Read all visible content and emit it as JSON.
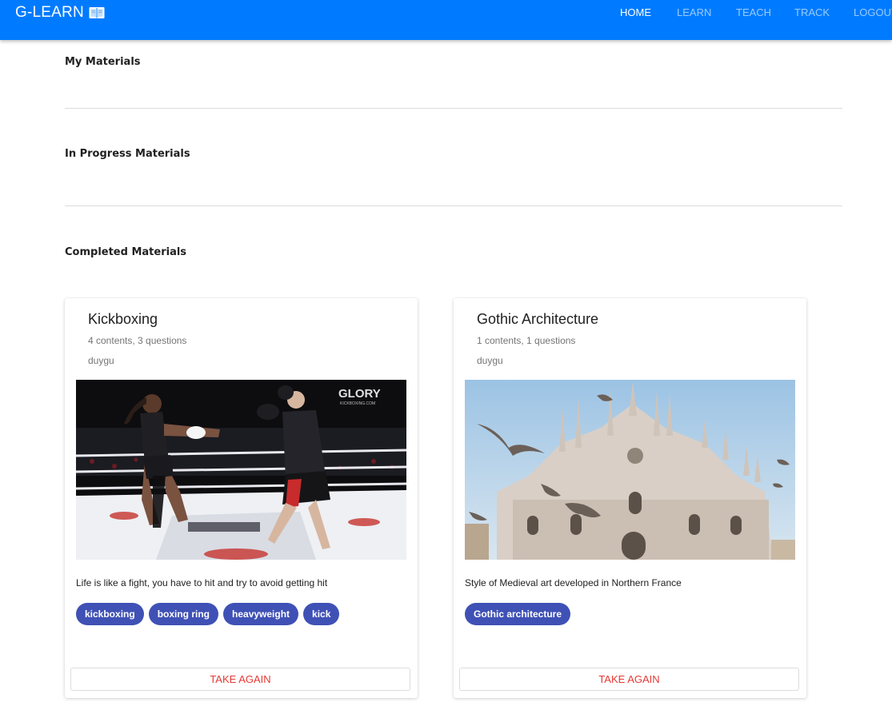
{
  "navbar": {
    "brand": "G-LEARN",
    "links": [
      {
        "label": "HOME",
        "active": true
      },
      {
        "label": "LEARN",
        "active": false
      },
      {
        "label": "TEACH",
        "active": false
      },
      {
        "label": "TRACK",
        "active": false
      },
      {
        "label": "LOGOUT",
        "active": false
      }
    ]
  },
  "sections": {
    "my_materials": "My Materials",
    "in_progress": "In Progress Materials",
    "completed": "Completed Materials"
  },
  "colors": {
    "navbar": "#007bff",
    "tag": "#3f51b5",
    "button_text": "#e53935"
  },
  "cards": [
    {
      "title": "Kickboxing",
      "subtitle": "4 contents, 3 questions",
      "author": "duygu",
      "description": "Life is like a fight, you have to hit and try to avoid getting hit",
      "tags": [
        "kickboxing",
        "boxing ring",
        "heavyweight",
        "kick"
      ],
      "button": "TAKE AGAIN",
      "image_text": "GLORY",
      "image_subtext": "KICKBOXING.COM"
    },
    {
      "title": "Gothic Architecture",
      "subtitle": "1 contents, 1 questions",
      "author": "duygu",
      "description": "Style of Medieval art developed in Northern France",
      "tags": [
        "Gothic architecture"
      ],
      "button": "TAKE AGAIN"
    }
  ]
}
